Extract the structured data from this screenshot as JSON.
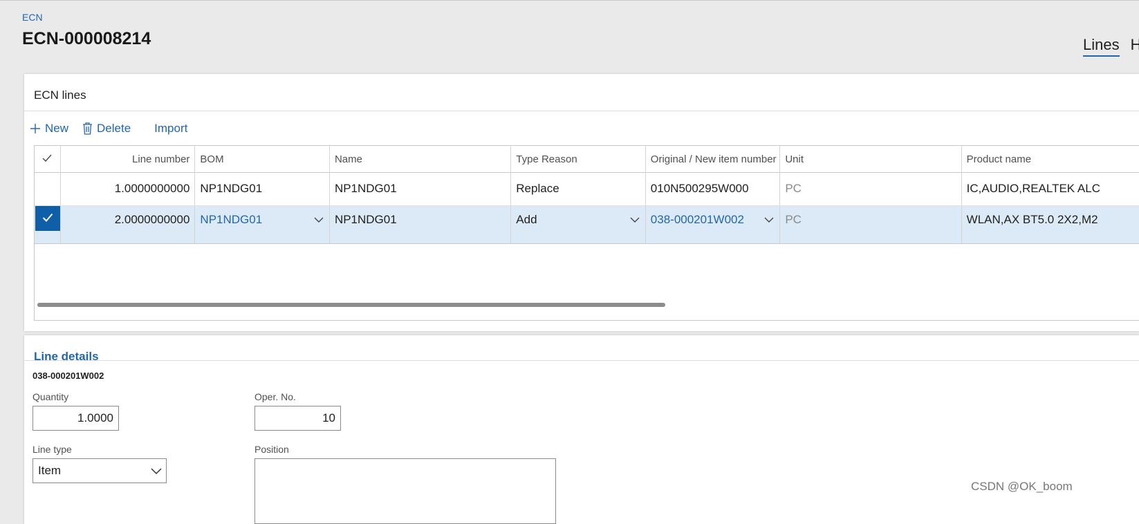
{
  "breadcrumb": "ECN",
  "page_title": "ECN-000008214",
  "tabs": [
    {
      "label": "Lines",
      "active": true
    },
    {
      "label": "H",
      "active": false
    }
  ],
  "lines_panel": {
    "title": "ECN lines",
    "toolbar": {
      "new": "New",
      "delete": "Delete",
      "import": "Import"
    },
    "columns": [
      "Line number",
      "BOM",
      "Name",
      "Type Reason",
      "Original / New item number",
      "Unit",
      "Product name"
    ],
    "rows": [
      {
        "selected": false,
        "line_number": "1.0000000000",
        "bom": "NP1NDG01",
        "name": "NP1NDG01",
        "type_reason": "Replace",
        "item_number": "010N500295W000",
        "unit": "PC",
        "product_name": "IC,AUDIO,REALTEK ALC"
      },
      {
        "selected": true,
        "line_number": "2.0000000000",
        "bom": "NP1NDG01",
        "name": "NP1NDG01",
        "type_reason": "Add",
        "item_number": "038-000201W002",
        "unit": "PC",
        "product_name": "WLAN,AX BT5.0 2X2,M2"
      }
    ]
  },
  "details_panel": {
    "title": "Line details",
    "item_id": "038-000201W002",
    "quantity": {
      "label": "Quantity",
      "value": "1.0000"
    },
    "oper_no": {
      "label": "Oper. No.",
      "value": "10"
    },
    "line_type": {
      "label": "Line type",
      "value": "Item"
    },
    "position": {
      "label": "Position",
      "value": ""
    }
  },
  "watermark": "CSDN @OK_boom",
  "colors": {
    "accent": "#2266b0",
    "selected_row": "#dce9f6",
    "selected_check": "#0f5fa8",
    "background": "#eaeaea"
  },
  "icons": {
    "new": "plus-icon",
    "delete": "trash-icon",
    "select_all": "check-icon",
    "dropdown": "chevron-down-icon"
  }
}
